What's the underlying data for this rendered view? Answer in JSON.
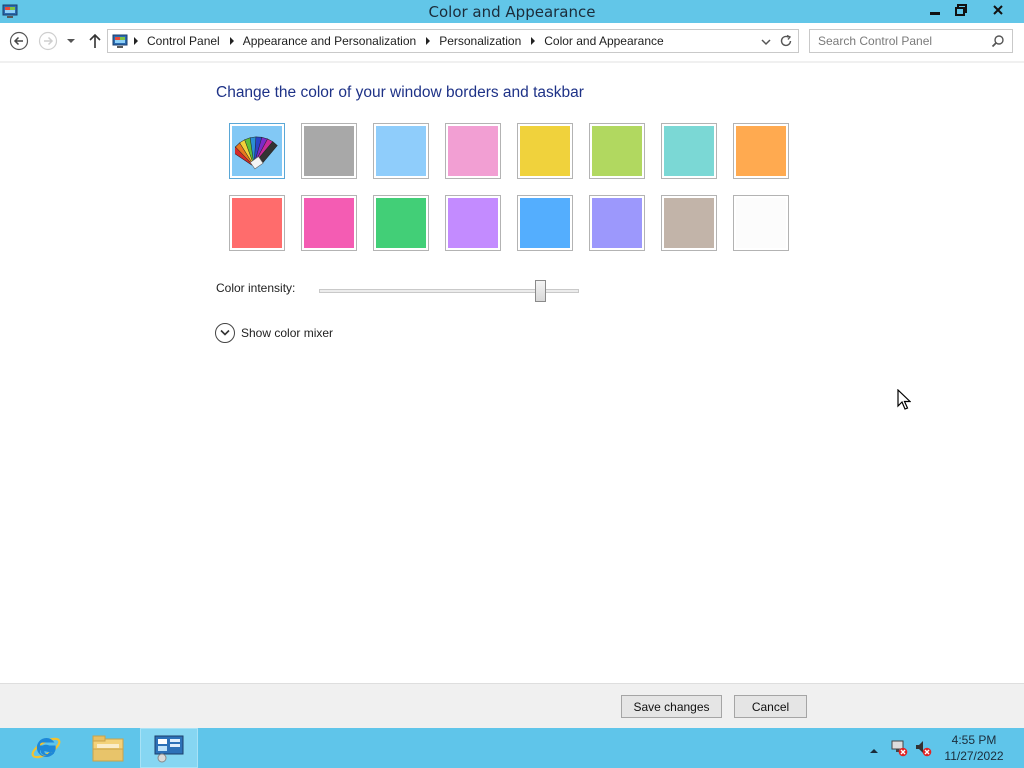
{
  "window": {
    "title": "Color and Appearance"
  },
  "nav": {
    "breadcrumbs": [
      "Control Panel",
      "Appearance and Personalization",
      "Personalization",
      "Color and Appearance"
    ],
    "search_placeholder": "Search Control Panel"
  },
  "content": {
    "heading": "Change the color of your window borders and taskbar",
    "swatches_row1": [
      {
        "name": "automatic",
        "color": "#82c8f5",
        "selected": true
      },
      {
        "name": "gray",
        "color": "#a8a8a8"
      },
      {
        "name": "sky-blue",
        "color": "#8fcdfb"
      },
      {
        "name": "pink",
        "color": "#f29fd3"
      },
      {
        "name": "yellow",
        "color": "#f0d23c"
      },
      {
        "name": "lime",
        "color": "#b1d860"
      },
      {
        "name": "teal",
        "color": "#7bd8d5"
      },
      {
        "name": "orange",
        "color": "#ffaa50"
      }
    ],
    "swatches_row2": [
      {
        "name": "red",
        "color": "#ff6c6c"
      },
      {
        "name": "magenta",
        "color": "#f45cb3"
      },
      {
        "name": "green",
        "color": "#42cf77"
      },
      {
        "name": "purple",
        "color": "#c38bff"
      },
      {
        "name": "blue",
        "color": "#54aefe"
      },
      {
        "name": "periwinkle",
        "color": "#9c98fc"
      },
      {
        "name": "taupe",
        "color": "#c2b4a9"
      },
      {
        "name": "white",
        "color": "#fcfcfc"
      }
    ],
    "intensity_label": "Color intensity:",
    "intensity_value": 0.85,
    "mixer_label": "Show color mixer"
  },
  "actions": {
    "save_label": "Save changes",
    "cancel_label": "Cancel"
  },
  "taskbar": {
    "time": "4:55 PM",
    "date": "11/27/2022"
  },
  "colors": {
    "titlebar": "#62c6e8",
    "taskbar": "#5fc5ea",
    "heading": "#1e3287"
  }
}
